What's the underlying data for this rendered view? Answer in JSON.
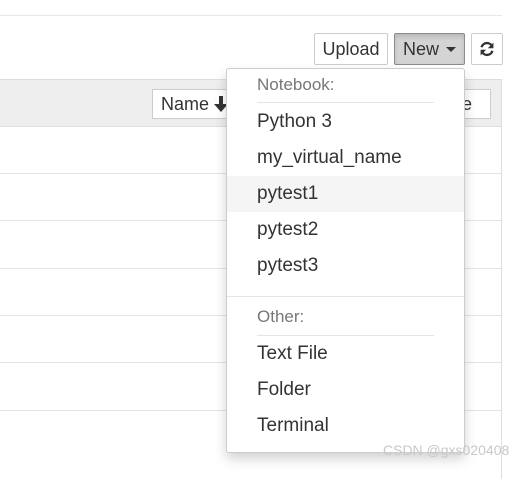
{
  "toolbar": {
    "upload_label": "Upload",
    "new_label": "New",
    "refresh_icon": "refresh-icon"
  },
  "file_list": {
    "sort_name_label": "Name",
    "sort_name_icon": "arrow-down-icon",
    "sort_size_label": "ze"
  },
  "new_menu": {
    "notebook_header": "Notebook:",
    "notebook_items": [
      "Python 3",
      "my_virtual_name",
      "pytest1",
      "pytest2",
      "pytest3"
    ],
    "highlighted_item": "pytest1",
    "other_header": "Other:",
    "other_items": [
      "Text File",
      "Folder",
      "Terminal"
    ]
  },
  "watermark": "CSDN @gxs020408"
}
